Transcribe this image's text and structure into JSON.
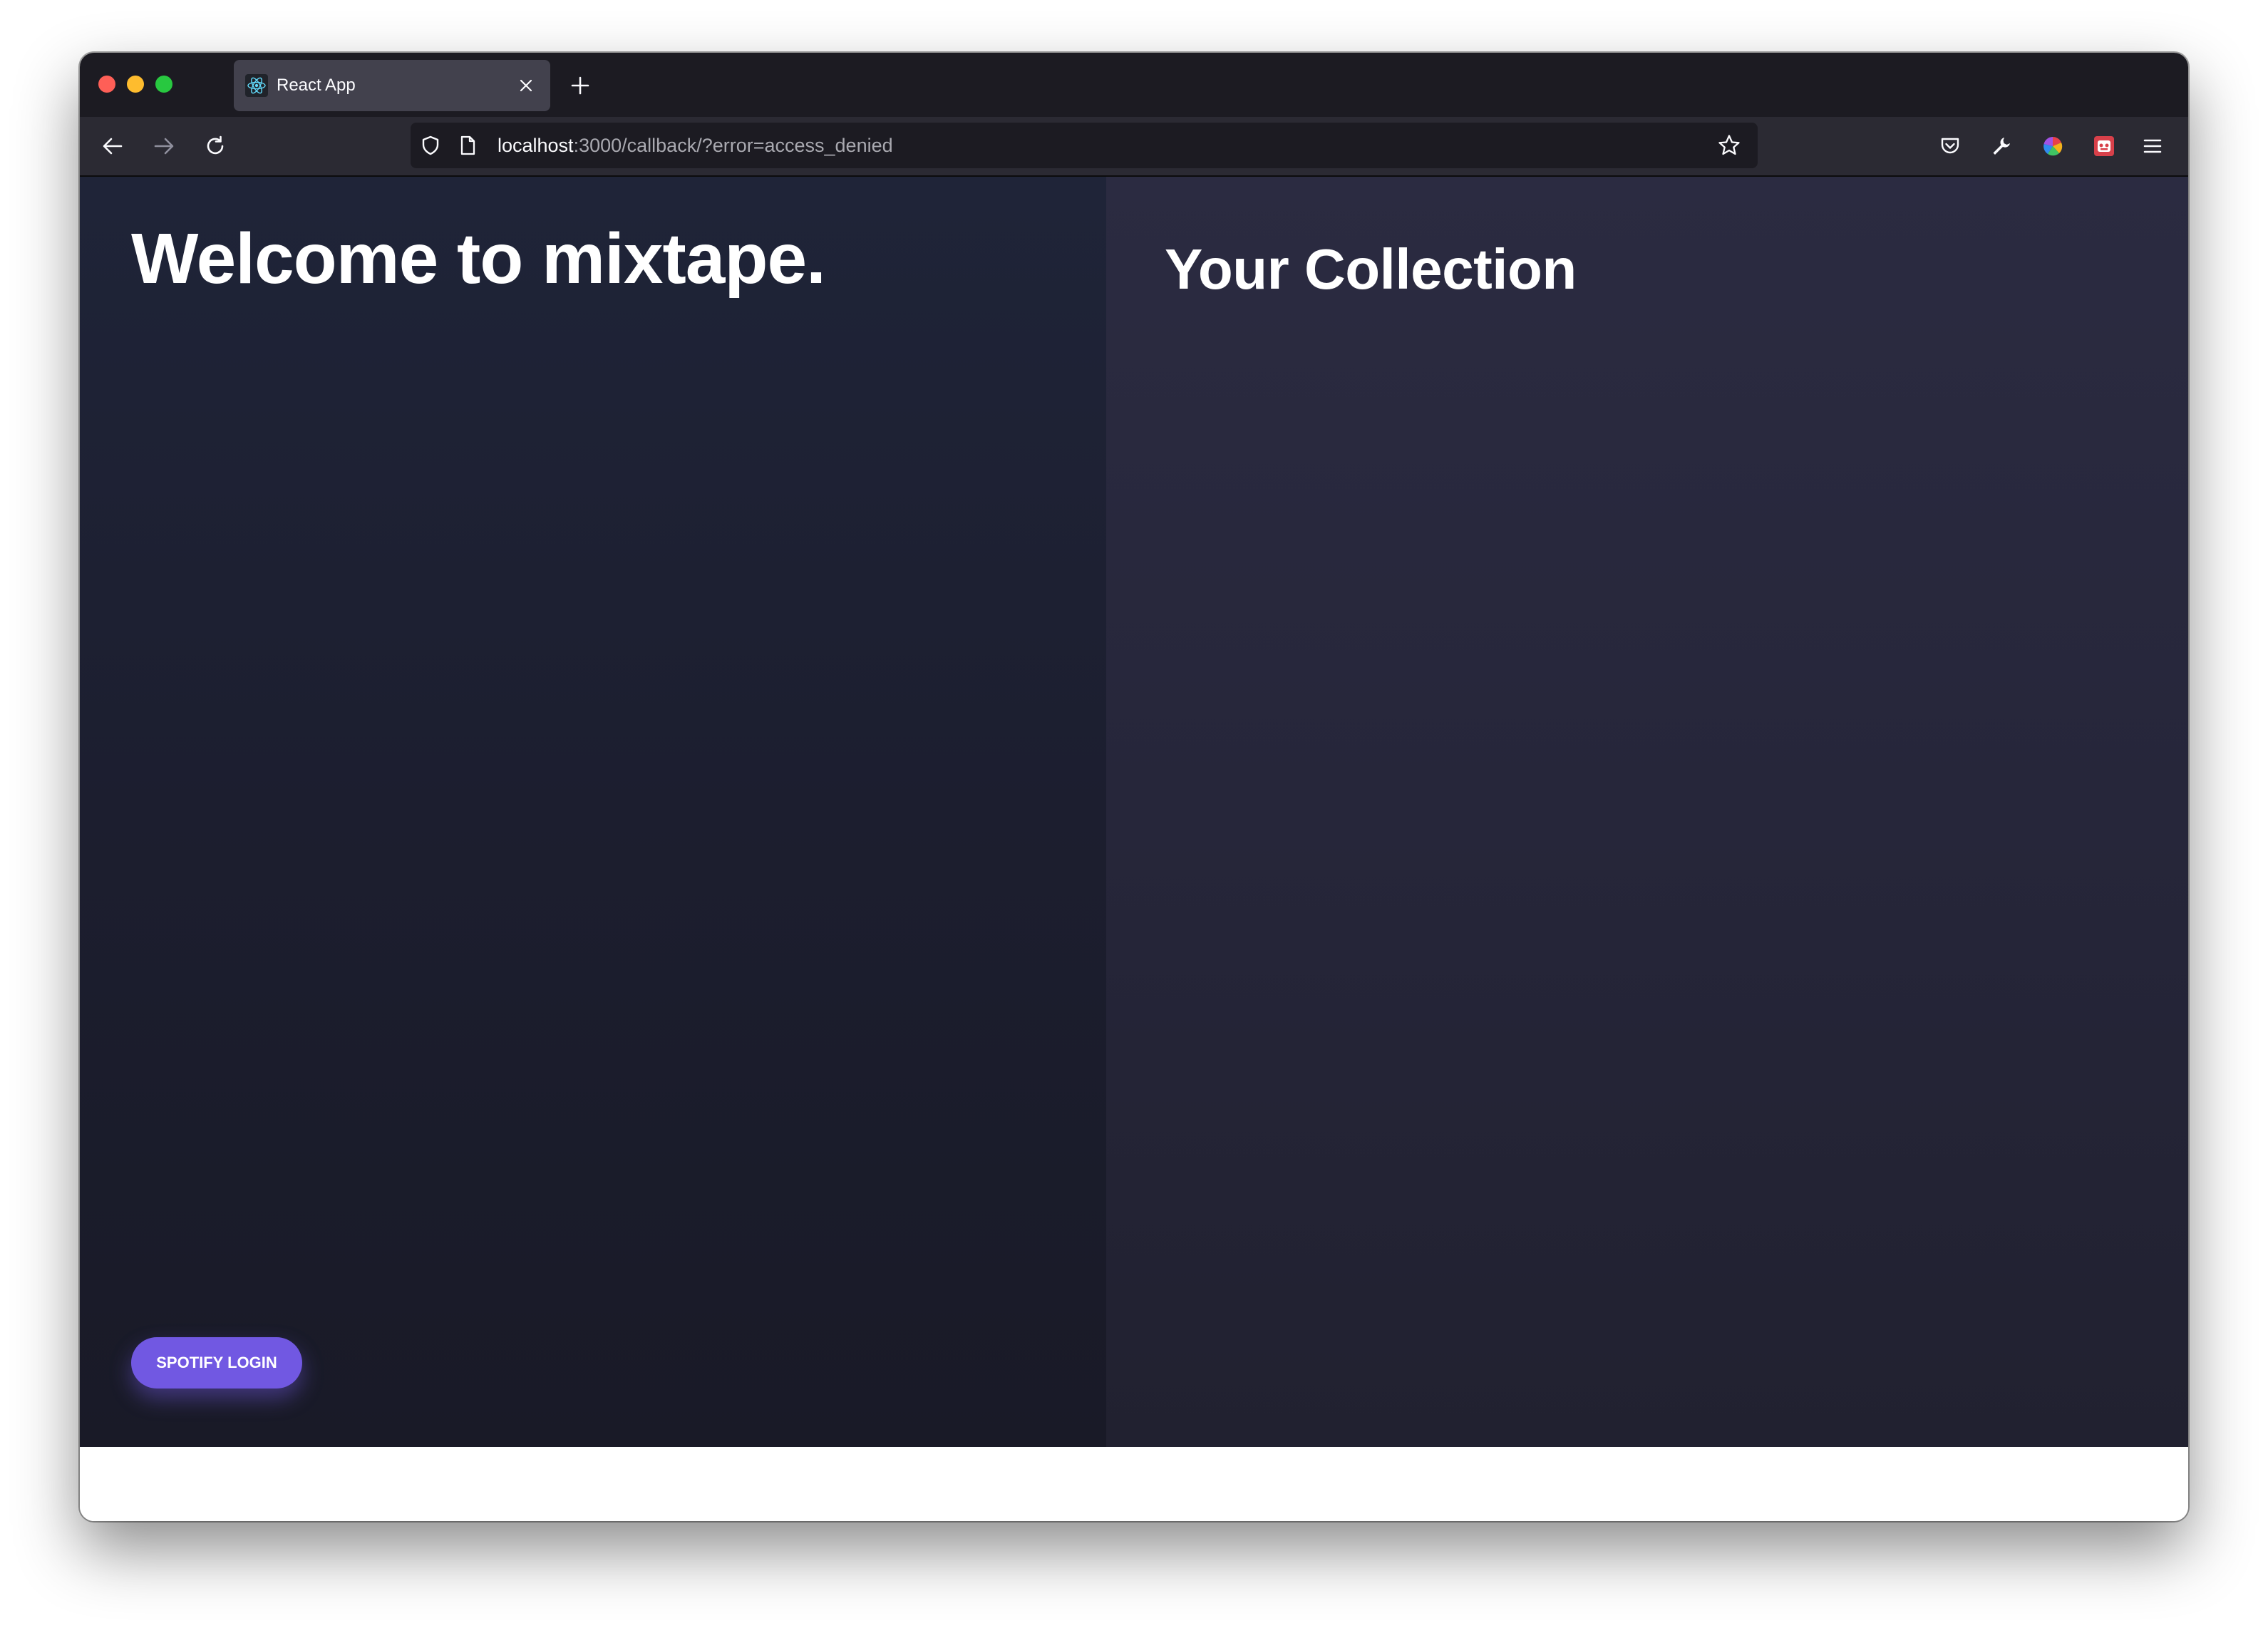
{
  "browser": {
    "tab": {
      "title": "React App",
      "favicon": "react-logo-icon"
    },
    "url": {
      "host": "localhost",
      "rest": ":3000/callback/?error=access_denied"
    },
    "toolbar_icons": [
      "pocket-icon",
      "wrench-icon",
      "color-wheel-icon",
      "extension-icon",
      "menu-icon"
    ]
  },
  "app": {
    "welcome_heading": "Welcome to mixtape.",
    "collection_heading": "Your Collection",
    "login_button": "SPOTIFY LOGIN"
  },
  "colors": {
    "accent": "#7158e2",
    "left_pane": "#1f2438",
    "right_pane": "#2b2b41",
    "chrome": "#1c1b22"
  }
}
